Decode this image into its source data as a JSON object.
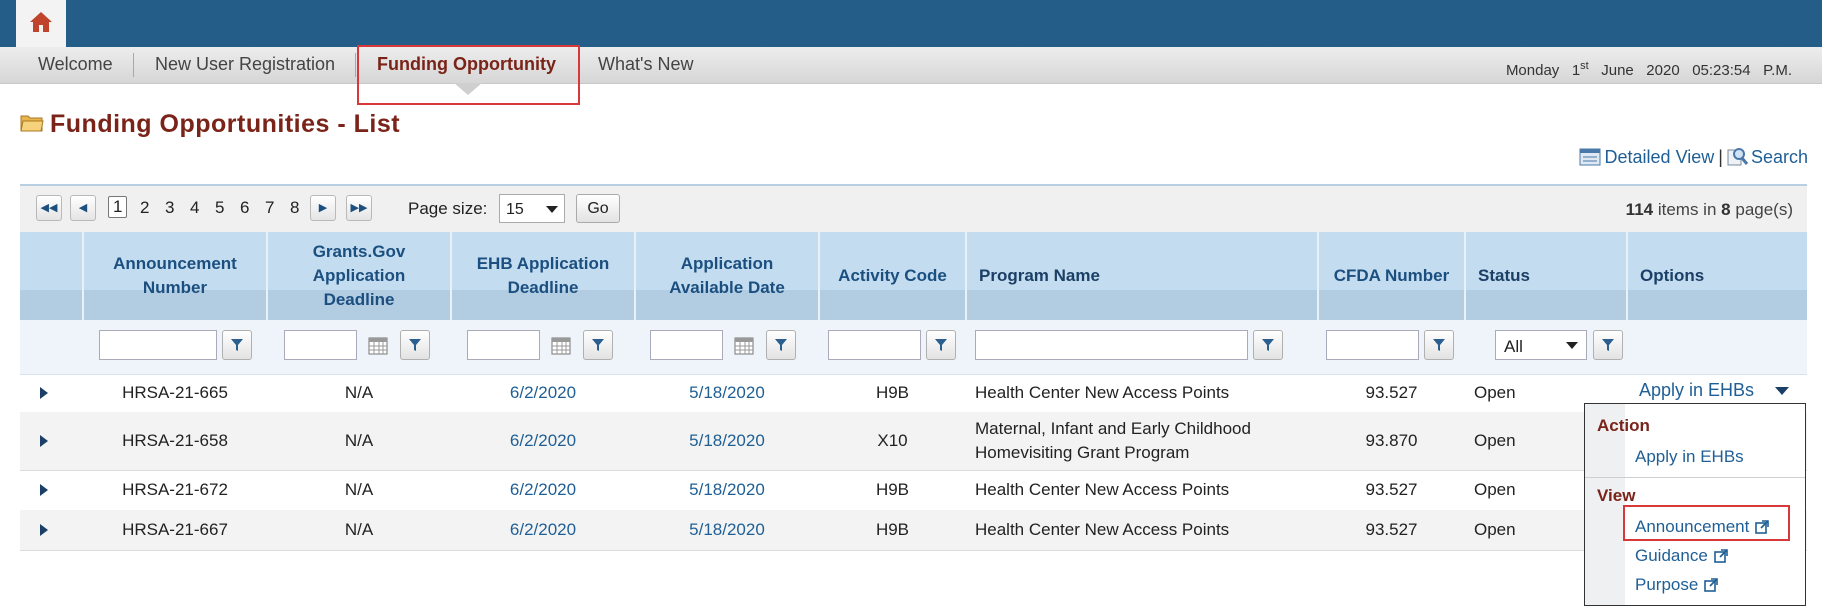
{
  "nav": {
    "items": [
      "Welcome",
      "New User Registration",
      "Funding Opportunity",
      "What's New"
    ],
    "datetime": {
      "weekday": "Monday",
      "day": "1",
      "suffix": "st",
      "month": "June",
      "year": "2020",
      "time": "05:23:54",
      "ampm": "P.M."
    }
  },
  "page": {
    "title": "Funding Opportunities - List",
    "detailed_view": "Detailed View",
    "separator": "|",
    "search": "Search"
  },
  "pager": {
    "pages": [
      "1",
      "2",
      "3",
      "4",
      "5",
      "6",
      "7",
      "8"
    ],
    "page_size_label": "Page size:",
    "page_size_value": "15",
    "go": "Go",
    "total_items": "114",
    "items_in_text": "items in",
    "total_pages": "8",
    "pages_text": "page(s)"
  },
  "columns": [
    "Announcement Number",
    "Grants.Gov Application Deadline",
    "EHB Application Deadline",
    "Application Available Date",
    "Activity Code",
    "Program Name",
    "CFDA Number",
    "Status",
    "Options"
  ],
  "filters": {
    "status_value": "All"
  },
  "rows": [
    {
      "announcement": "HRSA-21-665",
      "grants_gov": "N/A",
      "ehb_deadline": "6/2/2020",
      "available": "5/18/2020",
      "activity": "H9B",
      "program": "Health Center New Access Points",
      "cfda": "93.527",
      "status": "Open"
    },
    {
      "announcement": "HRSA-21-658",
      "grants_gov": "N/A",
      "ehb_deadline": "6/2/2020",
      "available": "5/18/2020",
      "activity": "X10",
      "program_line1": "Maternal, Infant and Early Childhood",
      "program_line2": "Homevisiting Grant Program",
      "cfda": "93.870",
      "status": "Open"
    },
    {
      "announcement": "HRSA-21-672",
      "grants_gov": "N/A",
      "ehb_deadline": "6/2/2020",
      "available": "5/18/2020",
      "activity": "H9B",
      "program": "Health Center New Access Points",
      "cfda": "93.527",
      "status": "Open"
    },
    {
      "announcement": "HRSA-21-667",
      "grants_gov": "N/A",
      "ehb_deadline": "6/2/2020",
      "available": "5/18/2020",
      "activity": "H9B",
      "program": "Health Center New Access Points",
      "cfda": "93.527",
      "status": "Open"
    }
  ],
  "options": {
    "apply_label": "Apply in EHBs",
    "menu": {
      "action_header": "Action",
      "apply": "Apply in EHBs",
      "view_header": "View",
      "announcement": "Announcement",
      "guidance": "Guidance",
      "purpose": "Purpose"
    }
  },
  "colors": {
    "brand": "#235d88",
    "title": "#7a2318",
    "link": "#1f5f95",
    "highlight": "#d9383a",
    "header_bg": "#c4dcef"
  }
}
